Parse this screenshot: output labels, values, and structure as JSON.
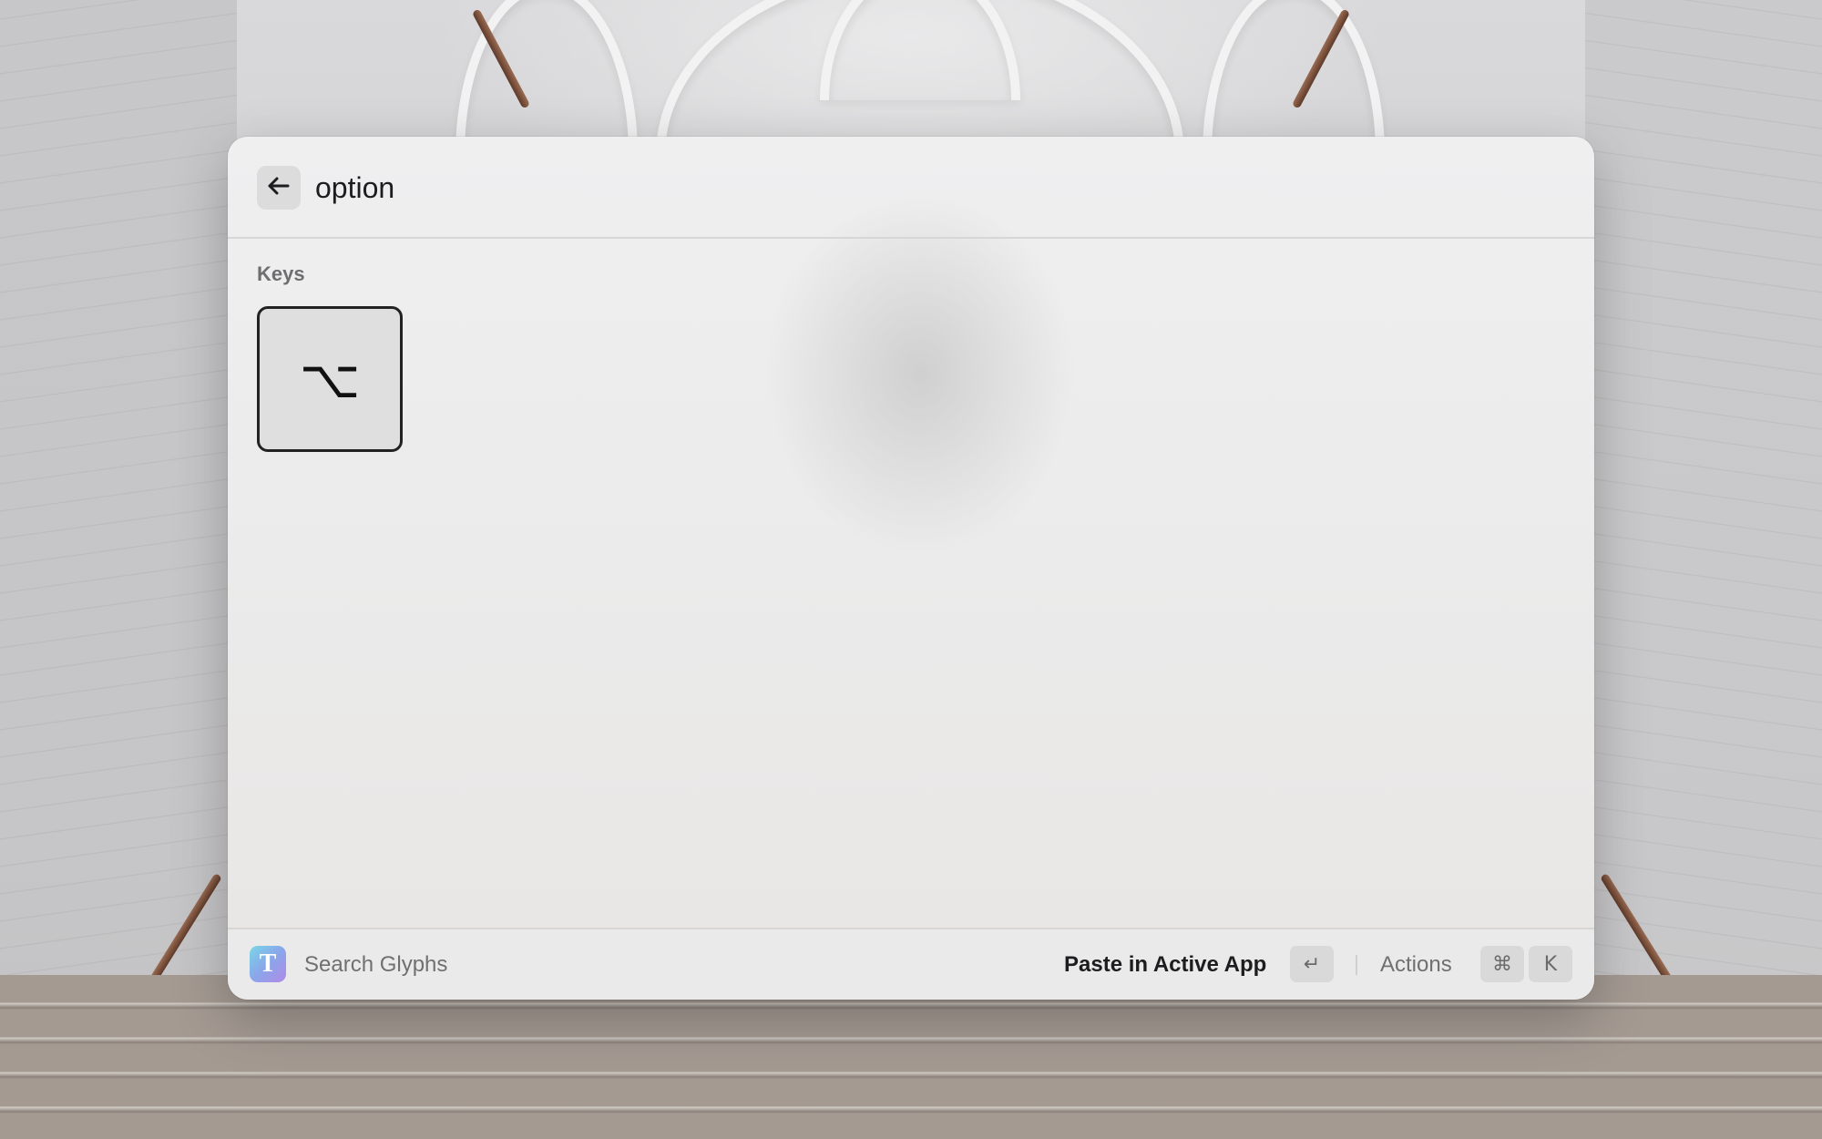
{
  "search": {
    "value": "option"
  },
  "results": {
    "section_title": "Keys",
    "items": [
      {
        "glyph": "⌥"
      }
    ]
  },
  "footer": {
    "app_icon_letter": "T",
    "title": "Search Glyphs",
    "primary_action_label": "Paste in Active App",
    "primary_action_key": "↵",
    "actions_label": "Actions",
    "actions_keys": [
      "⌘",
      "K"
    ]
  },
  "icons": {
    "back": "arrow-left-icon",
    "app": "glyphs-app-icon"
  }
}
